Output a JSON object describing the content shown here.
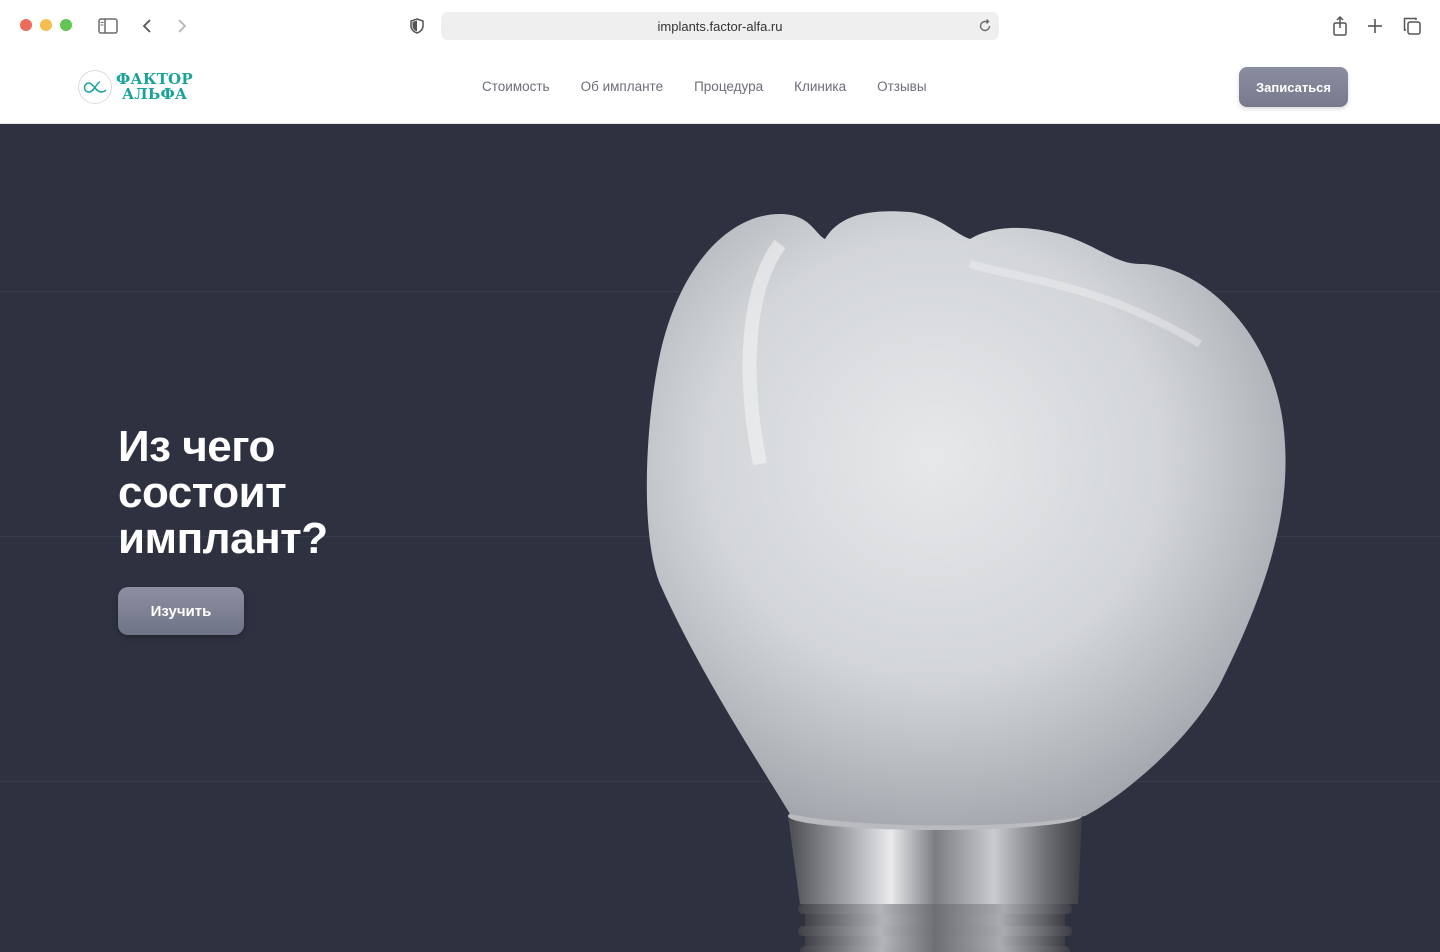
{
  "browser": {
    "url": "implants.factor-alfa.ru"
  },
  "header": {
    "logo_line1": "ФАКТОР",
    "logo_line2": "АЛЬФА",
    "nav": [
      {
        "label": "Стоимость"
      },
      {
        "label": "Об импланте"
      },
      {
        "label": "Процедура"
      },
      {
        "label": "Клиника"
      },
      {
        "label": "Отзывы"
      }
    ],
    "cta_label": "Записаться"
  },
  "hero": {
    "title_line1": "Из чего",
    "title_line2": "состоит",
    "title_line3": "имплант?",
    "button_label": "Изучить"
  },
  "colors": {
    "hero_bg": "#2e3140",
    "brand": "#1aa39a",
    "button": "#7f8396"
  }
}
